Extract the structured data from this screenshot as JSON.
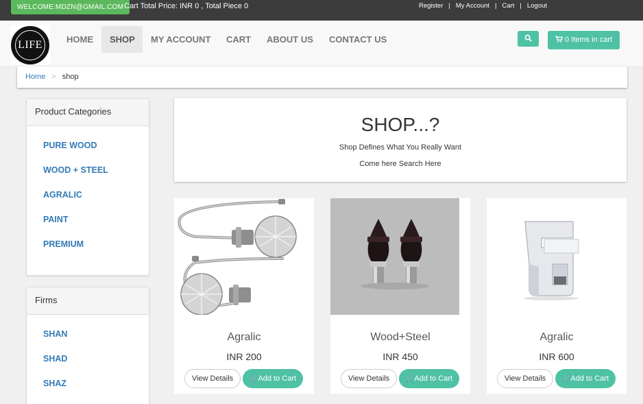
{
  "topbar": {
    "welcome": "WELCOME:MDZN@GMAIL.COM",
    "cart_summary": "Cart Total Price: INR 0 , Total Piece 0",
    "links": [
      "Register",
      "My Account",
      "Cart",
      "Logout"
    ]
  },
  "logo": {
    "text": "LIFE"
  },
  "nav": {
    "items": [
      "HOME",
      "SHOP",
      "MY ACCOUNT",
      "CART",
      "ABOUT US",
      "CONTACT US"
    ],
    "active": "SHOP",
    "cart_button": "0 Items in cart"
  },
  "breadcrumb": {
    "home": "Home",
    "separator": ">",
    "current": "shop"
  },
  "sidebar": {
    "categories": {
      "title": "Product Categories",
      "items": [
        "PURE WOOD",
        "WOOD + STEEL",
        "AGRALIC",
        "PAINT",
        "PREMIUM"
      ]
    },
    "firms": {
      "title": "Firms",
      "items": [
        "SHAN",
        "SHAD",
        "SHAZ"
      ]
    }
  },
  "shop_header": {
    "title": "SHOP...?",
    "subtitle": "Shop Defines What You Really Want",
    "tagline": "Come here Search Here"
  },
  "products": [
    {
      "name": "Agralic",
      "price": "INR 200",
      "details_label": "View Details",
      "add_label": "Add to Cart"
    },
    {
      "name": "Wood+Steel",
      "price": "INR 450",
      "details_label": "View Details",
      "add_label": "Add to Cart"
    },
    {
      "name": "Agralic",
      "price": "INR 600",
      "details_label": "View Details",
      "add_label": "Add to Cart"
    }
  ],
  "colors": {
    "accent": "#4fc1a5",
    "welcome_green": "#5cb85c",
    "link_blue": "#337ab7",
    "topbar": "#3c3c3c"
  },
  "icons": {
    "search": "search-icon",
    "cart": "shopping-cart-icon"
  }
}
